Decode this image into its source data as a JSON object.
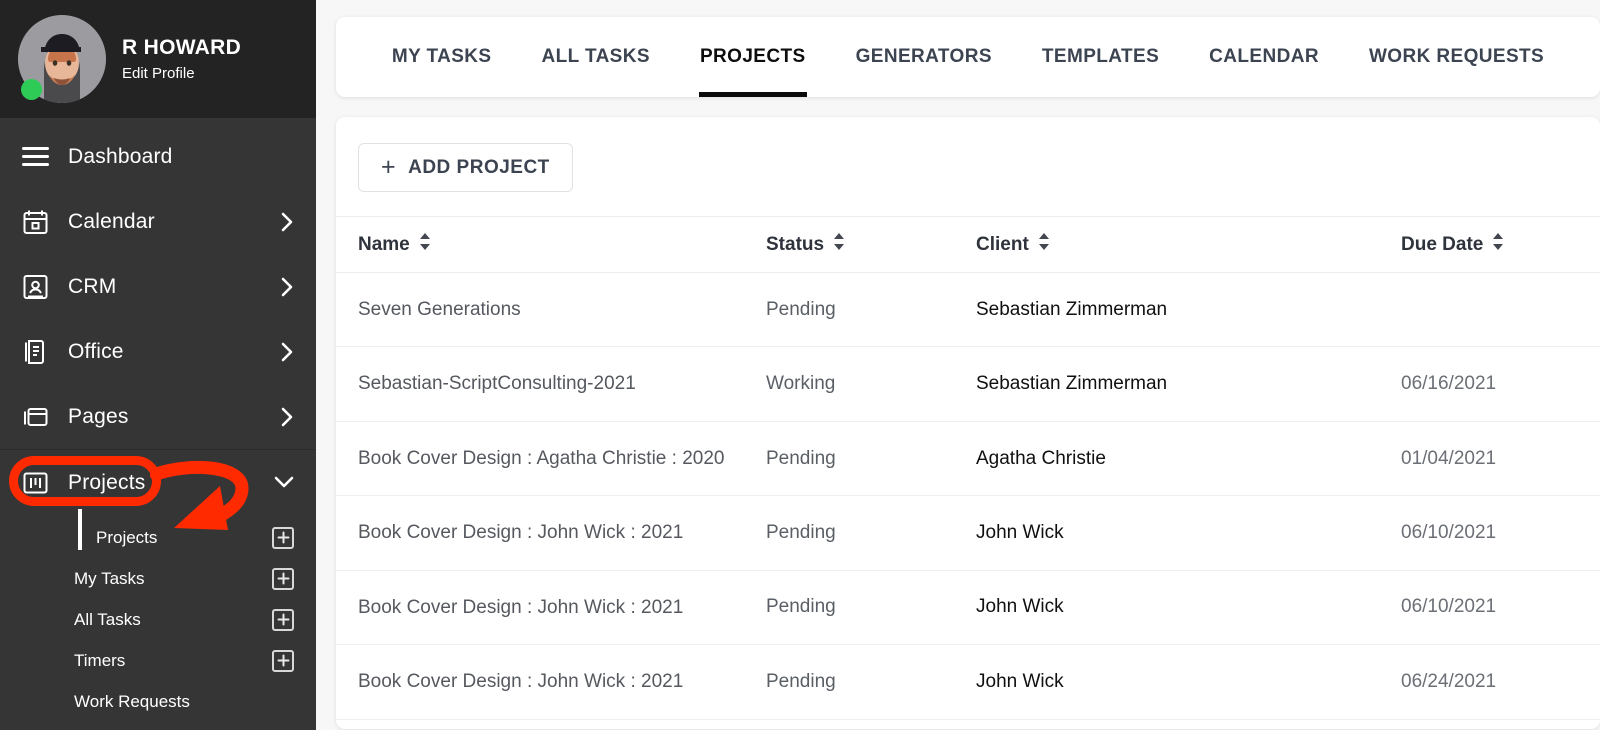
{
  "sidebar": {
    "user": {
      "name": "R HOWARD",
      "edit_link": "Edit Profile",
      "status": "online"
    },
    "nav": [
      {
        "label": "Dashboard",
        "icon": "hamburger-icon",
        "chevron": "none"
      },
      {
        "label": "Calendar",
        "icon": "calendar-icon",
        "chevron": "right"
      },
      {
        "label": "CRM",
        "icon": "contact-card-icon",
        "chevron": "right"
      },
      {
        "label": "Office",
        "icon": "document-icon",
        "chevron": "right"
      },
      {
        "label": "Pages",
        "icon": "pages-icon",
        "chevron": "right"
      },
      {
        "label": "Projects",
        "icon": "kanban-board-icon",
        "chevron": "down"
      }
    ],
    "sub_items": [
      {
        "label": "Projects",
        "active": true,
        "add": true
      },
      {
        "label": "My Tasks",
        "active": false,
        "add": true
      },
      {
        "label": "All Tasks",
        "active": false,
        "add": true
      },
      {
        "label": "Timers",
        "active": false,
        "add": true
      },
      {
        "label": "Work Requests",
        "active": false,
        "add": false
      }
    ]
  },
  "annotation": {
    "color": "#ff2a00",
    "target": "Projects",
    "shape": "ring-and-arrow"
  },
  "tabs": [
    {
      "label": "MY TASKS",
      "active": false
    },
    {
      "label": "ALL TASKS",
      "active": false
    },
    {
      "label": "PROJECTS",
      "active": true
    },
    {
      "label": "GENERATORS",
      "active": false
    },
    {
      "label": "TEMPLATES",
      "active": false
    },
    {
      "label": "CALENDAR",
      "active": false
    },
    {
      "label": "WORK REQUESTS",
      "active": false
    }
  ],
  "toolbar": {
    "add_project_label": "ADD PROJECT",
    "add_icon": "plus-icon"
  },
  "table": {
    "columns": [
      {
        "label": "Name",
        "sortable": true
      },
      {
        "label": "Status",
        "sortable": true
      },
      {
        "label": "Client",
        "sortable": true
      },
      {
        "label": "Due Date",
        "sortable": true
      }
    ],
    "rows": [
      {
        "name": "Seven Generations",
        "status": "Pending",
        "client": "Sebastian Zimmerman",
        "due": ""
      },
      {
        "name": "Sebastian-ScriptConsulting-2021",
        "status": "Working",
        "client": "Sebastian Zimmerman",
        "due": "06/16/2021"
      },
      {
        "name": "Book Cover Design : Agatha Christie : 2020",
        "status": "Pending",
        "client": "Agatha Christie",
        "due": "01/04/2021"
      },
      {
        "name": "Book Cover Design : John Wick : 2021",
        "status": "Pending",
        "client": "John Wick",
        "due": "06/10/2021"
      },
      {
        "name": "Book Cover Design : John Wick : 2021",
        "status": "Pending",
        "client": "John Wick",
        "due": "06/10/2021"
      },
      {
        "name": "Book Cover Design : John Wick : 2021",
        "status": "Pending",
        "client": "John Wick",
        "due": "06/24/2021"
      }
    ]
  }
}
